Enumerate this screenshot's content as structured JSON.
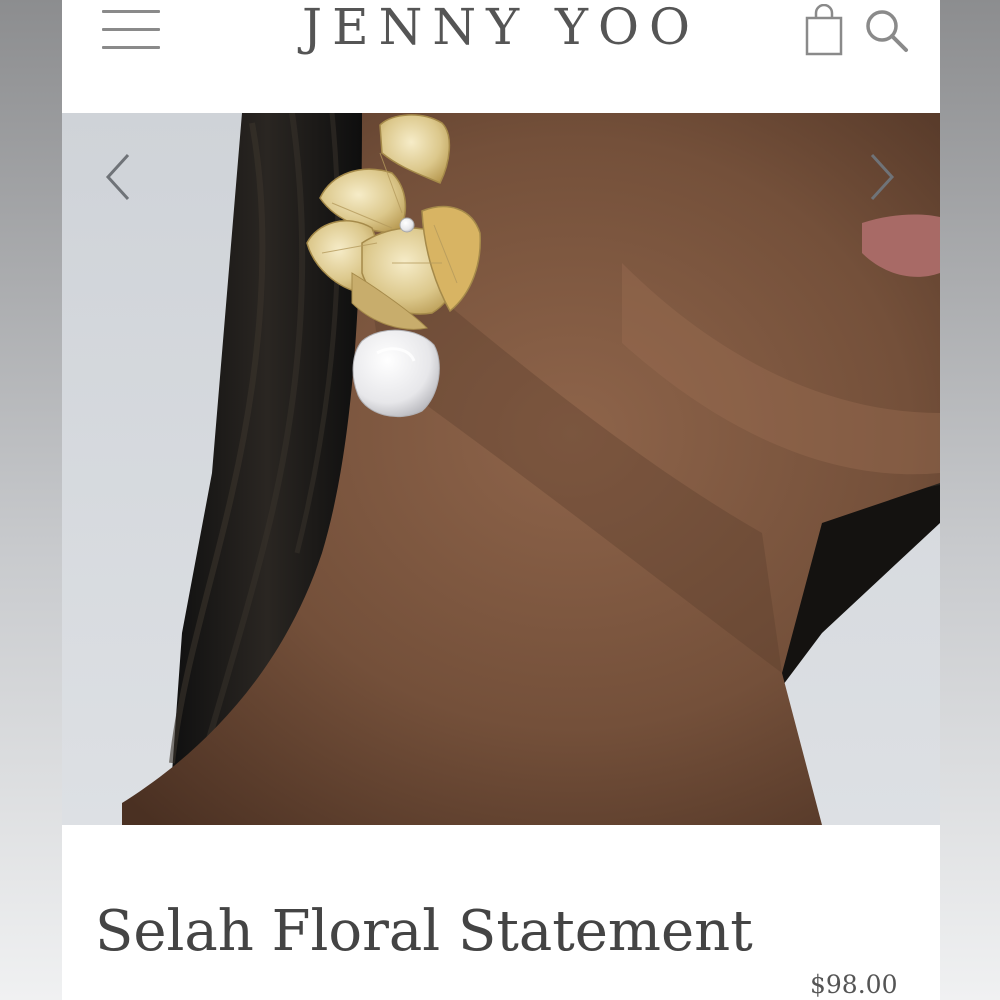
{
  "header": {
    "brand": "JENNY YOO",
    "menu_icon": "hamburger-menu-icon",
    "bag_icon": "shopping-bag-icon",
    "search_icon": "search-icon"
  },
  "gallery": {
    "prev_icon": "chevron-left-icon",
    "next_icon": "chevron-right-icon"
  },
  "product": {
    "title": "Selah Floral Statement",
    "price": "$98.00"
  },
  "colors": {
    "icon_gray": "#8a8a8a",
    "text": "#444444"
  }
}
